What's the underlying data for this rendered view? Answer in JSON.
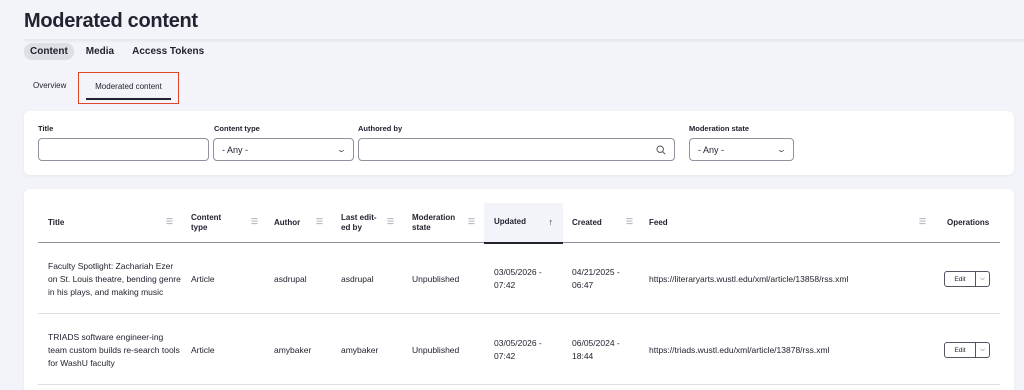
{
  "page": {
    "title": "Moderated content"
  },
  "primary_tabs": [
    {
      "label": "Content",
      "active": true
    },
    {
      "label": "Media",
      "active": false
    },
    {
      "label": "Access Tokens",
      "active": false
    }
  ],
  "secondary_tabs": [
    {
      "label": "Overview",
      "active": false
    },
    {
      "label": "Moderated content",
      "active": true
    }
  ],
  "filters": {
    "title": {
      "label": "Title",
      "value": ""
    },
    "content_type": {
      "label": "Content type",
      "value": "- Any -",
      "icon": "chevron-down-icon"
    },
    "authored_by": {
      "label": "Authored by",
      "value": "",
      "icon": "search-icon"
    },
    "moderation_state": {
      "label": "Moderation state",
      "value": "- Any -",
      "icon": "chevron-down-icon"
    }
  },
  "table": {
    "columns": [
      {
        "label": "Title",
        "sortable": true
      },
      {
        "label": "Content type",
        "sortable": true
      },
      {
        "label": "Author",
        "sortable": true
      },
      {
        "label": "Last edit-ed by",
        "sortable": true
      },
      {
        "label": "Moderation state",
        "sortable": true
      },
      {
        "label": "Updated",
        "sortable": true,
        "sorted": "ascending"
      },
      {
        "label": "Created",
        "sortable": true
      },
      {
        "label": "Feed",
        "sortable": true
      },
      {
        "label": "Operations",
        "sortable": false
      }
    ],
    "rows": [
      {
        "title": "Faculty Spotlight: Zachariah Ezer on St. Louis theatre, bending genre in his plays, and making music",
        "content_type": "Article",
        "author": "asdrupal",
        "last_edited_by": "asdrupal",
        "moderation_state": "Unpublished",
        "updated": "03/05/2026 - 07:42",
        "created": "04/21/2025 - 06:47",
        "feed": "https://literaryarts.wustl.edu/xml/article/13858/rss.xml",
        "operation": "Edit"
      },
      {
        "title": "TRIADS software engineer-ing team custom builds re-search tools for WashU faculty",
        "content_type": "Article",
        "author": "amybaker",
        "last_edited_by": "amybaker",
        "moderation_state": "Unpublished",
        "updated": "03/05/2026 - 07:42",
        "created": "06/05/2024 - 18:44",
        "feed": "https://triads.wustl.edu/xml/article/13878/rss.xml",
        "operation": "Edit"
      }
    ]
  },
  "colors": {
    "background": "#f3f4f9",
    "text": "#222330",
    "highlight_border": "#e1462c",
    "active_tab_bg": "#dedfe4"
  }
}
